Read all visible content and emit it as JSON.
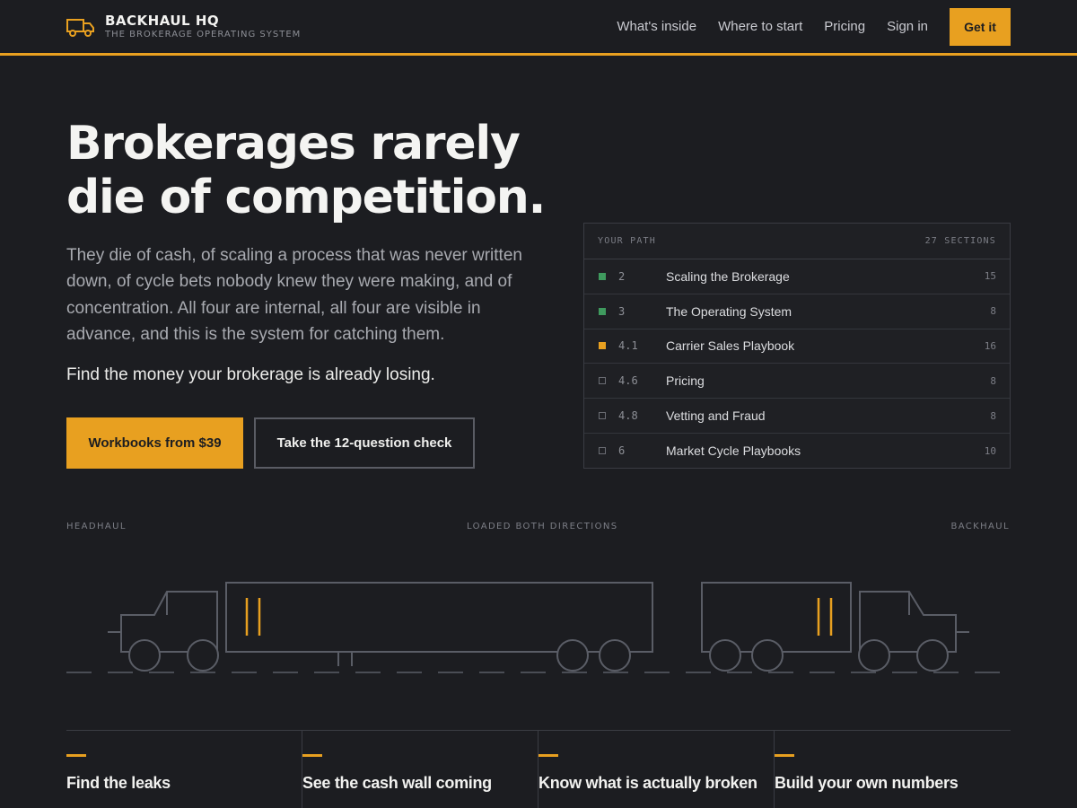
{
  "brand": {
    "name": "BACKHAUL HQ",
    "tagline": "THE BROKERAGE OPERATING SYSTEM"
  },
  "nav": {
    "links": [
      "What's inside",
      "Where to start",
      "Pricing",
      "Sign in"
    ],
    "cta": "Get it"
  },
  "hero": {
    "title": "Brokerages rarely die of competition.",
    "body": "They die of cash, of scaling a process that was never written down, of cycle bets nobody knew they were making, and of concentration. All four are internal, all four are visible in advance, and this is the system for catching them.",
    "lead": "Find the money your brokerage is already losing.",
    "primary_button": "Workbooks from $39",
    "secondary_button": "Take the 12-question check"
  },
  "path_panel": {
    "label": "YOUR PATH",
    "total": "27 SECTIONS",
    "rows": [
      {
        "status": "done",
        "num": "2",
        "title": "Scaling the Brokerage",
        "count": "15"
      },
      {
        "status": "done",
        "num": "3",
        "title": "The Operating System",
        "count": "8"
      },
      {
        "status": "active",
        "num": "4.1",
        "title": "Carrier Sales Playbook",
        "count": "16"
      },
      {
        "status": "todo",
        "num": "4.6",
        "title": "Pricing",
        "count": "8"
      },
      {
        "status": "todo",
        "num": "4.8",
        "title": "Vetting and Fraud",
        "count": "8"
      },
      {
        "status": "todo",
        "num": "6",
        "title": "Market Cycle Playbooks",
        "count": "10"
      }
    ]
  },
  "truck_section": {
    "left_label": "HEADHAUL",
    "center_label": "LOADED BOTH DIRECTIONS",
    "right_label": "BACKHAUL"
  },
  "features": [
    {
      "title": "Find the leaks"
    },
    {
      "title": "See the cash wall coming"
    },
    {
      "title": "Know what is actually broken"
    },
    {
      "title": "Build your own numbers"
    }
  ],
  "colors": {
    "accent": "#e8a020",
    "background": "#1c1d21",
    "done": "#3f9a5e"
  },
  "icons": {
    "brand": "truck-icon"
  }
}
